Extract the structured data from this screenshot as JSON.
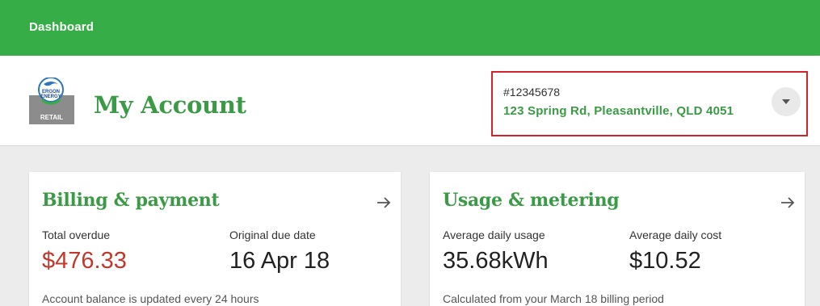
{
  "topbar": {
    "nav_label": "Dashboard",
    "color": "#36ad47"
  },
  "header": {
    "logo": {
      "text_line1": "ERGON",
      "text_line2": "ENERGY",
      "retail": "RETAIL"
    },
    "title": "My Account",
    "account": {
      "number": "#12345678",
      "address": "123 Spring Rd, Pleasantville, QLD 4051",
      "dropdown_icon": "caret-down-icon"
    }
  },
  "cards": {
    "billing": {
      "title": "Billing & payment",
      "arrow_icon": "arrow-right-icon",
      "metric1": {
        "label": "Total overdue",
        "value": "$476.33"
      },
      "metric2": {
        "label": "Original due date",
        "value": "16 Apr 18"
      },
      "note": "Account balance is updated every 24 hours"
    },
    "usage": {
      "title": "Usage & metering",
      "arrow_icon": "arrow-right-icon",
      "metric1": {
        "label": "Average daily usage",
        "value": "35.68kWh"
      },
      "metric2": {
        "label": "Average daily cost",
        "value": "$10.52"
      },
      "note": "Calculated from your March 18 billing period"
    }
  },
  "colors": {
    "brand_green": "#3a9a45",
    "overdue_red": "#c0392b",
    "highlight_border": "#d2232a"
  }
}
